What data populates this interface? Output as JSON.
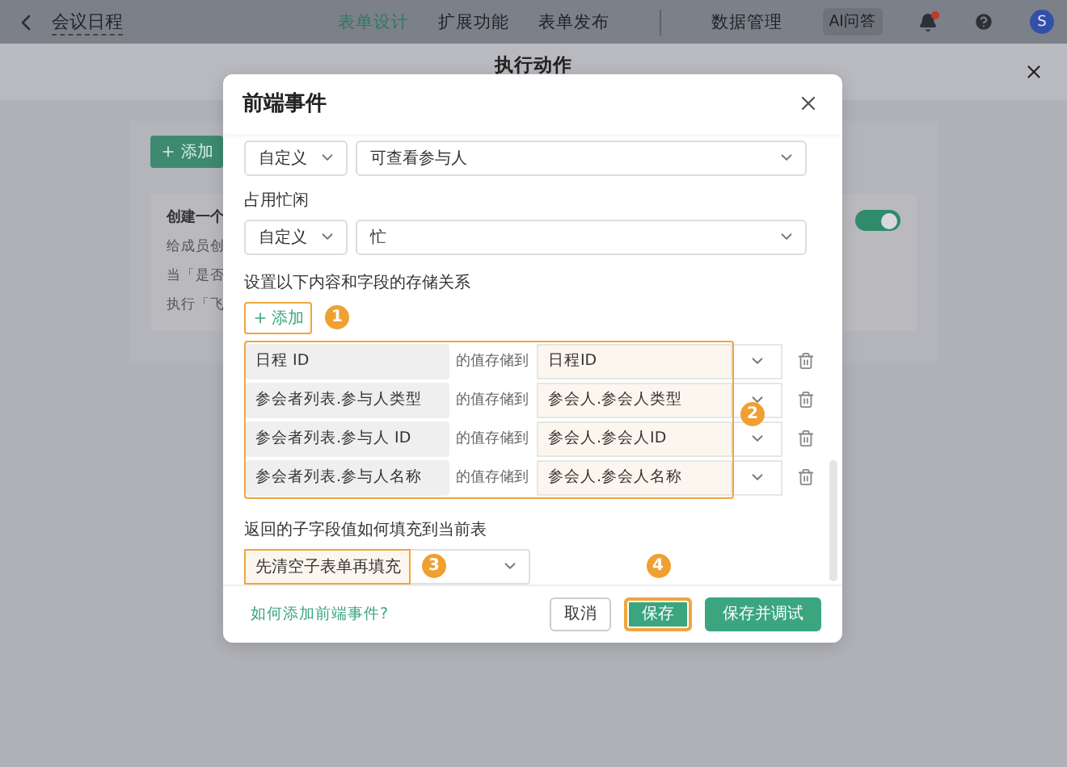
{
  "topbar": {
    "title": "会议日程",
    "tabs": [
      {
        "label": "表单设计",
        "selected": true
      },
      {
        "label": "扩展功能",
        "selected": false
      },
      {
        "label": "表单发布",
        "selected": false
      },
      {
        "label": "数据管理",
        "selected": false
      }
    ],
    "ai_button": "AI问答",
    "notification": true,
    "avatar": "S"
  },
  "panel": {
    "title": "执行动作",
    "add_button": "添加",
    "card": {
      "title": "创建一个",
      "lines": [
        "给成员创",
        "当「是否",
        "执行「飞"
      ],
      "toggle": {
        "on": true
      }
    }
  },
  "dialog": {
    "title": "前端事件",
    "fields": [
      {
        "mode": "自定义",
        "value": "可查看参与人"
      },
      {
        "label": "占用忙闲",
        "mode": "自定义",
        "value": "忙"
      }
    ],
    "mapping": {
      "heading": "设置以下内容和字段的存储关系",
      "add_button": {
        "label": "添加",
        "highlighted": true,
        "marker": "1"
      },
      "highlighted": true,
      "marker": "2",
      "rows": [
        {
          "source": "日程 ID",
          "relation": "的值存储到",
          "target": "日程ID"
        },
        {
          "source": "参会者列表.参与人类型",
          "relation": "的值存储到",
          "target": "参会人.参会人类型"
        },
        {
          "source": "参会者列表.参与人 ID",
          "relation": "的值存储到",
          "target": "参会人.参会人ID"
        },
        {
          "source": "参会者列表.参与人名称",
          "relation": "的值存储到",
          "target": "参会人.参会人名称"
        }
      ]
    },
    "fill": {
      "label": "返回的子字段值如何填充到当前表",
      "value": "先清空子表单再填充",
      "highlighted": true,
      "marker": "3"
    },
    "footer": {
      "help_link": "如何添加前端事件?",
      "buttons": [
        {
          "label": "取消",
          "kind": "default",
          "highlighted": false
        },
        {
          "label": "保存",
          "kind": "primary",
          "highlighted": true,
          "marker": "4"
        },
        {
          "label": "保存并调试",
          "kind": "primary",
          "highlighted": false
        }
      ]
    }
  }
}
